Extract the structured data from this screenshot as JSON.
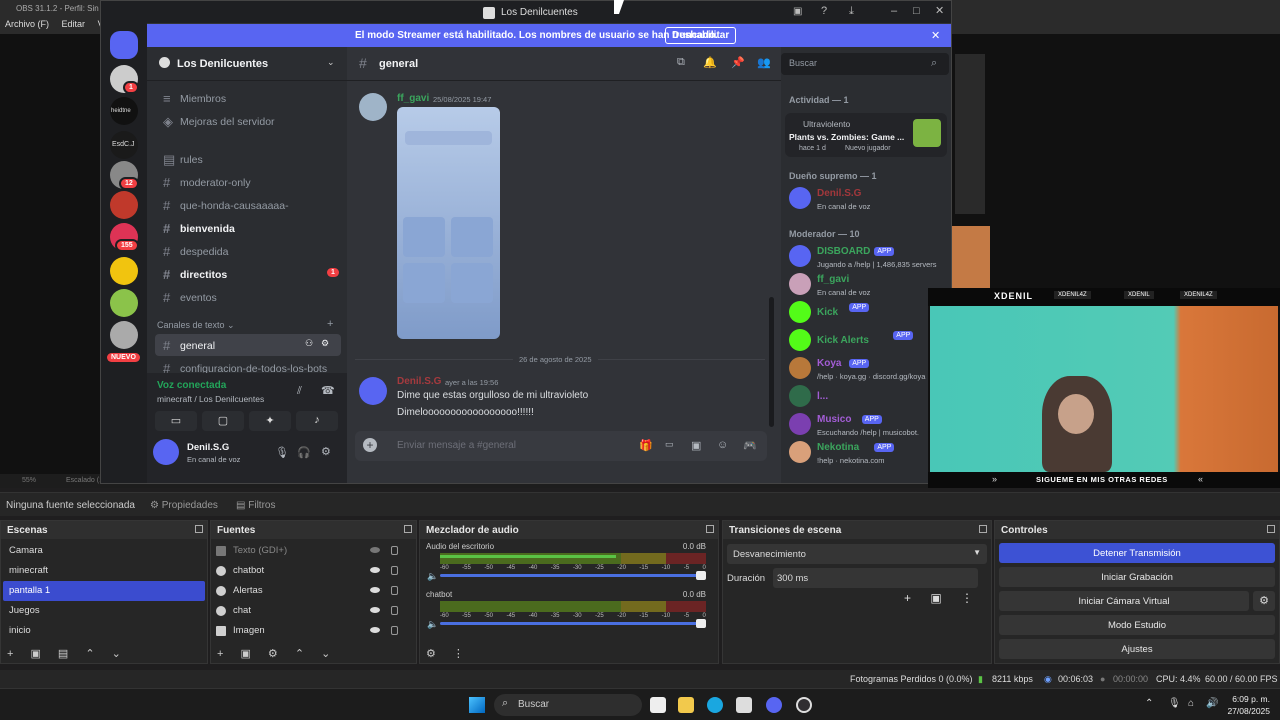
{
  "obs": {
    "title": "OBS 31.1.2 - Perfil: Sin T",
    "menu": [
      "Archivo (F)",
      "Editar",
      "Vi"
    ],
    "preview_zoom": "55%",
    "preview_scale": "Escalado (1065x601)",
    "no_source": "Ninguna fuente seleccionada",
    "properties": "Propiedades",
    "filters": "Filtros",
    "docks": {
      "scenes": {
        "title": "Escenas",
        "items": [
          "Camara",
          "minecraft",
          "pantalla 1",
          "Juegos",
          "inicio"
        ],
        "selected": "pantalla 1"
      },
      "sources": {
        "title": "Fuentes",
        "items": [
          "Texto (GDI+)",
          "chatbot",
          "Alertas",
          "chat",
          "Imagen"
        ]
      },
      "mixer": {
        "title": "Mezclador de audio",
        "channels": [
          {
            "name": "Audio del escritorio",
            "db": "0.0 dB",
            "level": 0.66
          },
          {
            "name": "chatbot",
            "db": "0.0 dB",
            "level": 0
          }
        ],
        "scale": [
          "-60",
          "-55",
          "-50",
          "-45",
          "-40",
          "-35",
          "-30",
          "-25",
          "-20",
          "-15",
          "-10",
          "-5",
          "0"
        ]
      },
      "transitions": {
        "title": "Transiciones de escena",
        "transition": "Desvanecimiento",
        "duration_label": "Duración",
        "duration": "300 ms"
      },
      "controls": {
        "title": "Controles",
        "buttons": [
          "Detener Transmisión",
          "Iniciar Grabación",
          "Iniciar Cámara Virtual",
          "Modo Estudio",
          "Ajustes"
        ]
      }
    },
    "status": {
      "dropped": "Fotogramas Perdidos 0 (0.0%)",
      "kbps": "8211 kbps",
      "stream_time": "00:06:03",
      "rec_time": "00:00:00",
      "cpu": "CPU: 4.4%",
      "fps": "60.00 / 60.00 FPS"
    }
  },
  "discord": {
    "window_title": "Los Denilcuentes",
    "banner": "El modo Streamer está habilitado. Los nombres de usuario se han truncado.",
    "banner_button": "Deshabilitar",
    "server_name": "Los Denilcuentes",
    "server_links": [
      "Miembros",
      "Mejoras del servidor"
    ],
    "guild_labels": [
      "heidtne",
      "EsdC.J"
    ],
    "guild_badges": [
      "1",
      "12",
      "155"
    ],
    "new_label": "NUEVO",
    "channels": [
      {
        "name": "rules",
        "bold": false
      },
      {
        "name": "moderator-only",
        "bold": false
      },
      {
        "name": "que-honda-causaaaaa-",
        "bold": false
      },
      {
        "name": "bienvenida",
        "bold": true
      },
      {
        "name": "despedida",
        "bold": false
      },
      {
        "name": "directitos",
        "bold": true,
        "badge": "1"
      },
      {
        "name": "eventos",
        "bold": false
      }
    ],
    "category": "Canales de texto",
    "channels2": [
      "general",
      "configuracion-de-todos-los-bots"
    ],
    "voice": {
      "status": "Voz conectada",
      "channel": "minecraft / Los Denilcuentes"
    },
    "user": {
      "name": "Denil.S.G",
      "status": "En canal de voz"
    },
    "chat": {
      "channel": "general",
      "search": "Buscar",
      "msg1": {
        "author": "ff_gavi",
        "time": "25/08/2025 19:47"
      },
      "date_divider": "26 de agosto de 2025",
      "msg2": {
        "author": "Denil.S.G",
        "time": "ayer a las 19:56",
        "lines": [
          "Dime que estas orgulloso de mi ultravioleto",
          "Dimelooooooooooooooooo!!!!!!"
        ]
      },
      "input_placeholder": "Enviar mensaje a #general"
    },
    "activity": {
      "header": "Actividad — 1",
      "label": "Ultraviolento",
      "game": "Plants vs. Zombies: Game ...",
      "meta1": "hace 1 d",
      "meta2": "Nuevo jugador"
    },
    "members": {
      "owner_header": "Dueño supremo — 1",
      "owner": {
        "name": "Denil.S.G",
        "status": "En canal de voz"
      },
      "mod_header": "Moderador — 10",
      "list": [
        {
          "name": "DISBOARD",
          "app": "APP",
          "status": "Jugando a /help | 1,486,835 servers",
          "color": "#3ba55d"
        },
        {
          "name": "ff_gavi",
          "app": "",
          "status": "En canal de voz",
          "color": "#3ba55d"
        },
        {
          "name": "Kick",
          "app": "APP",
          "status": "",
          "color": "#3ba55d"
        },
        {
          "name": "Kick Alerts",
          "app": "APP",
          "status": "",
          "color": "#3ba55d"
        },
        {
          "name": "Koya",
          "app": "APP",
          "status": "/help · koya.gg · discord.gg/koya",
          "color": "#a35dd6"
        },
        {
          "name": "l...",
          "app": "",
          "status": "",
          "color": "#a35dd6"
        },
        {
          "name": "Musico",
          "app": "APP",
          "status": "Escuchando /help | musicobot.",
          "color": "#a35dd6"
        },
        {
          "name": "Nekotina",
          "app": "APP",
          "status": "!help · nekotina.com",
          "color": "#3ba55d"
        }
      ],
      "app_label": "APP"
    }
  },
  "overlay": {
    "brand": "XDENIL",
    "follow": "SIGUEME EN MIS OTRAS REDES",
    "handles": [
      "XDENIL4Z",
      "XDENIL",
      "XDENIL4Z"
    ]
  },
  "taskbar": {
    "search": "Buscar",
    "time": "6:09 p. m.",
    "date": "27/08/2025"
  }
}
